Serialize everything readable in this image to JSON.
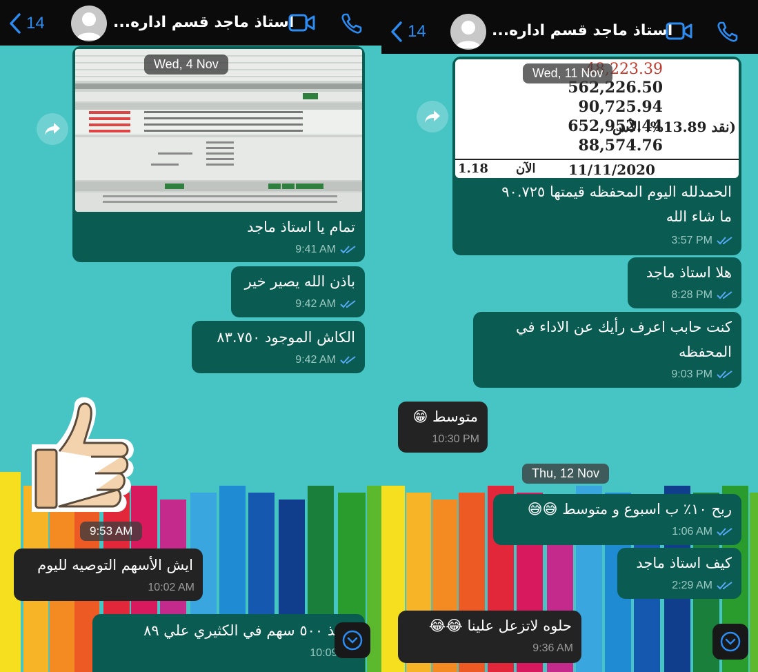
{
  "contact": {
    "name": "استاذ ماجد قسم اداره...",
    "back_count": "14"
  },
  "colors": {
    "wallpaper": "#47c4c4",
    "bubble_out": "#0a5c52",
    "bubble_in": "#232323",
    "accent": "#2c8cf2"
  },
  "icons": {
    "back": "chevron-left-icon",
    "video": "video-call-icon",
    "phone": "phone-icon",
    "forward": "forward-icon",
    "scroll": "chevron-down-icon",
    "read": "double-check-icon"
  },
  "left": {
    "date_chip": "Wed, 4 Nov",
    "messages": [
      {
        "text": "تمام يا استاذ ماجد",
        "time": "9:41 AM"
      },
      {
        "text": "باذن الله يصير خير",
        "time": "9:42 AM"
      },
      {
        "text": "الكاش الموجود ٨٣.٧٥٠",
        "time": "9:42 AM"
      },
      {
        "sticker_time": "9:53 AM"
      },
      {
        "text": "ايش الأسهم التوصيه لليوم",
        "time": "10:02 AM"
      },
      {
        "text": "تنفيذ ٥٠٠ سهم في الكثيري علي ٨٩",
        "time": "10:09 AM"
      }
    ]
  },
  "right": {
    "date_chip_1": "Wed, 11 Nov",
    "image_numbers": [
      "-48,223.39",
      "562,226.50",
      "90,725.94",
      "652,952.44",
      "88,574.76"
    ],
    "image_pct": "(نقد 13.89%، الأس",
    "image_footer": {
      "left": "1.18",
      "mid": "الآن",
      "date": "11/11/2020"
    },
    "messages": [
      {
        "text_line1": "الحمدلله اليوم المحفظه قيمتها ٩٠.٧٢٥",
        "text_line2": "ما شاء الله",
        "time": "3:57 PM"
      },
      {
        "text": "هلا استاذ ماجد",
        "time": "8:28 PM"
      },
      {
        "text_line1": "كنت حابب اعرف رأيك عن الاداء في",
        "text_line2": "المحفظه",
        "time": "9:03 PM"
      },
      {
        "text": "متوسط 😁",
        "time": "10:30 PM"
      },
      {
        "text": "ربح ١٠٪ ب اسبوع و متوسط 😅😅",
        "time": "1:06 AM"
      },
      {
        "text": "كيف استاذ ماجد",
        "time": "2:29 AM"
      },
      {
        "text": "حلوه لاتزعل علينا 😂😂",
        "time": "9:36 AM"
      }
    ],
    "date_chip_2": "Thu, 12 Nov"
  }
}
